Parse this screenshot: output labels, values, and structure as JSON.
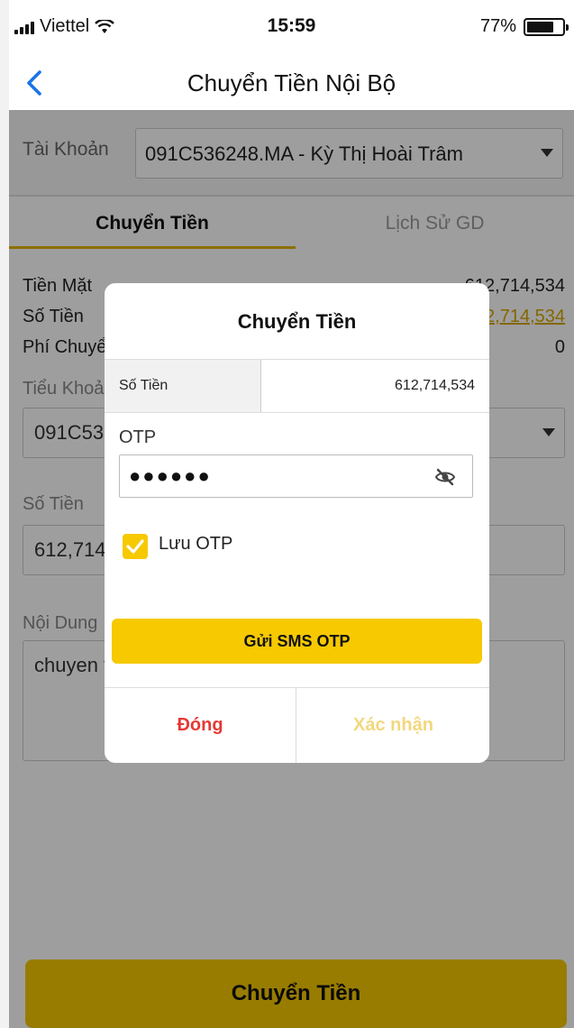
{
  "status_bar": {
    "carrier": "Viettel",
    "time": "15:59",
    "battery": "77%",
    "battery_level": 0.77
  },
  "nav": {
    "title": "Chuyển Tiền Nội Bộ"
  },
  "account": {
    "label": "Tài Khoản",
    "value": "091C536248.MA - Kỳ Thị Hoài Trâm"
  },
  "tabs": [
    {
      "label": "Chuyển Tiền",
      "active": true
    },
    {
      "label": "Lịch Sử GD",
      "active": false
    }
  ],
  "form": {
    "cash_label": "Tiền Mặt",
    "cash_value": "612,714,534",
    "amount_label": "Số Tiền",
    "amount_value": "612,714,534",
    "fee_label": "Phí Chuyển",
    "fee_value": "0",
    "subaccount_label": "Tiểu Khoản",
    "subaccount_value": "091C536248",
    "amount_field_label": "Số Tiền",
    "amount_field_value": "612,714,534",
    "content_label": "Nội Dung",
    "content_value": "chuyen tien"
  },
  "dialog": {
    "title": "Chuyển Tiền",
    "amount_label": "Số Tiền",
    "amount_value": "612,714,534",
    "otp_label": "OTP",
    "otp_dots": "●●●●●●",
    "save_otp_label": "Lưu OTP",
    "save_otp_checked": true,
    "sms_button": "Gửi SMS OTP",
    "close_button": "Đóng",
    "confirm_button": "Xác nhận"
  },
  "bottom_button": "Chuyển Tiền",
  "colors": {
    "accent": "#f6c900",
    "tab_underline": "#e3b200",
    "close_red": "#e53935"
  }
}
